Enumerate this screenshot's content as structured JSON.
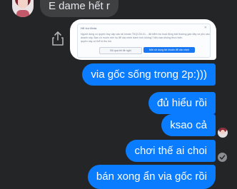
{
  "incoming": {
    "message": "E dame hết r"
  },
  "preview": {
    "header": "Hỗ trợ Meta",
    "close_glyph": "✕",
    "line1": "Người dùng có quyền truy cập vào tài khoản TKQC00-01... đã kiểm tra hoạt động bất thường gần đây và yêu cầu",
    "line2": "doanh này. Bạn có muốn mời họ để xác minh danh tính không? Nếu bạn không thực hiện",
    "line3": "quyền này có thể bị thu hồi.",
    "secondary_button": "Bỏ qua lời đề nghị",
    "primary_button": "Mời sử dụng tài khoản để xác minh"
  },
  "outgoing": [
    "via gốc sống trong 2p:)))",
    "đủ hiểu rồi",
    "ksao cả",
    "chơi thế ai choi",
    "bán xong ẩn via gốc rồi"
  ],
  "colors": {
    "background": "#242526",
    "incoming_bubble": "#3e4042",
    "outgoing_bubble": "#0a7cff"
  },
  "icons": {
    "share": "share-icon",
    "seen": "seen-avatar-icon",
    "sent": "sent-check-icon"
  }
}
